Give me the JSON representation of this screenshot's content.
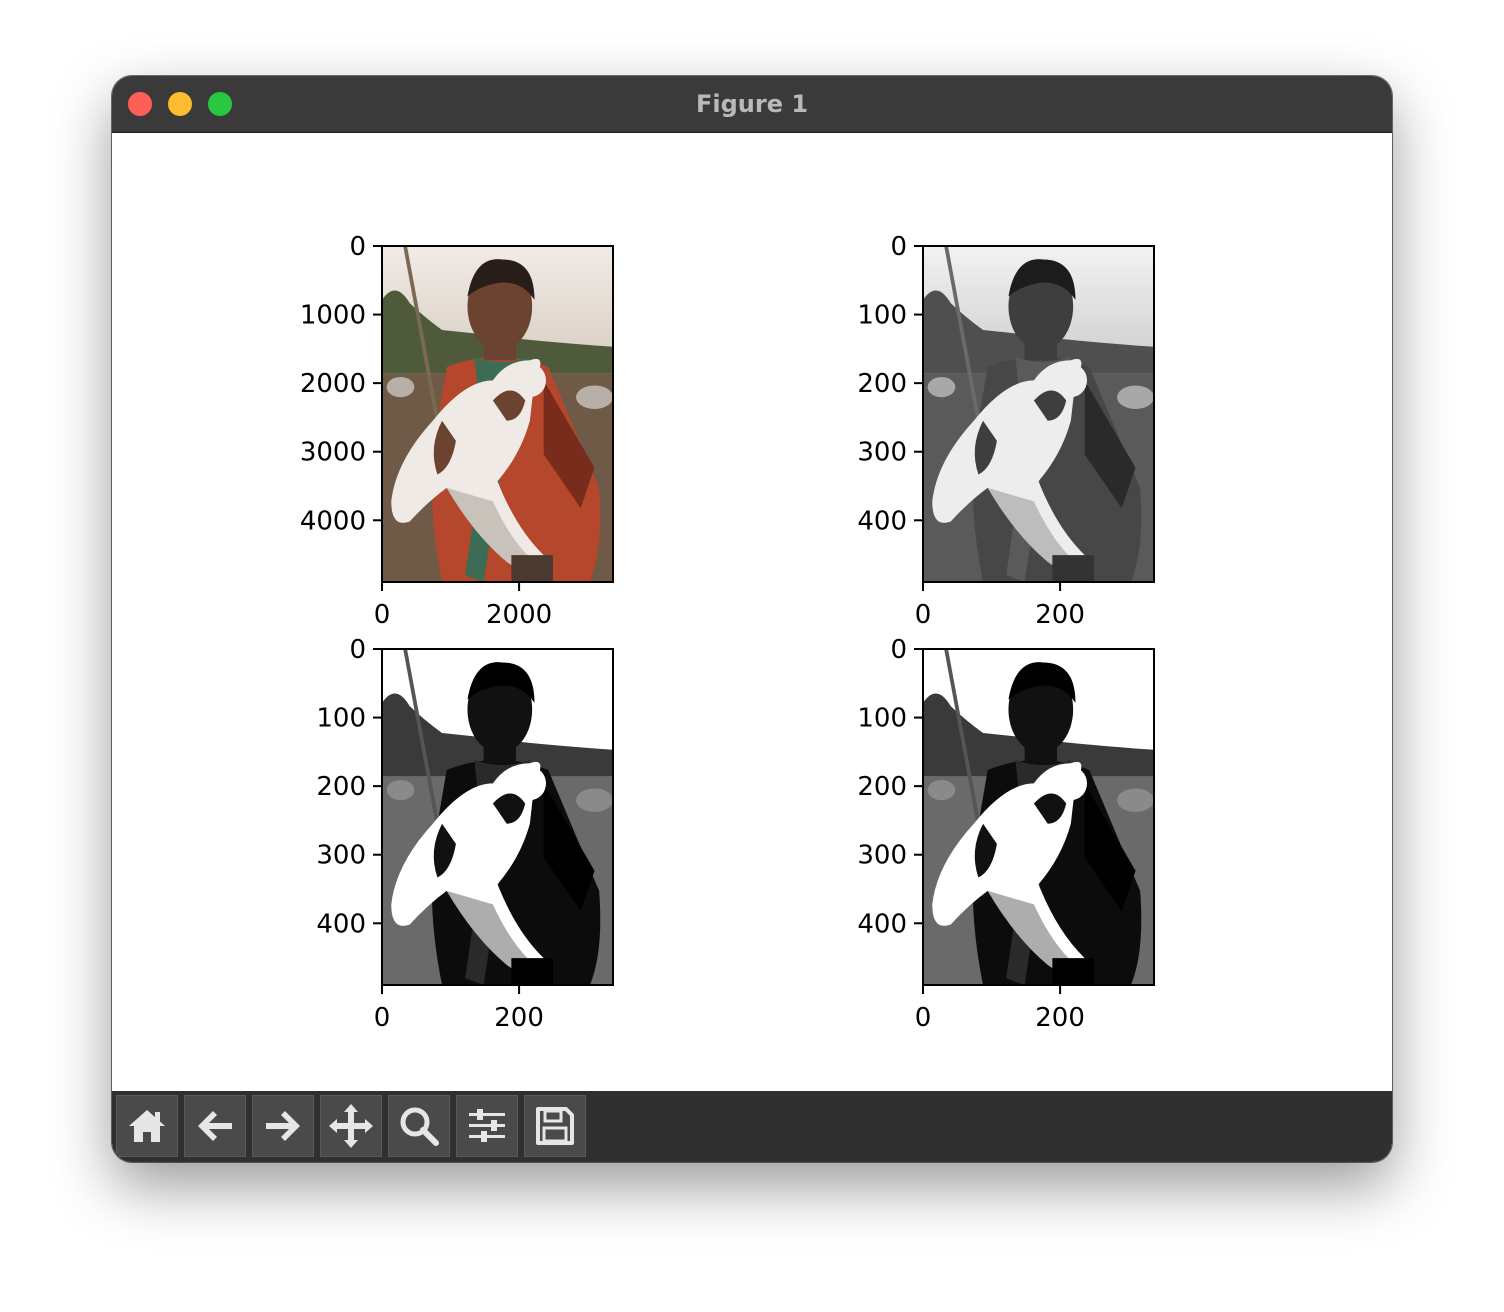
{
  "window": {
    "title": "Figure 1"
  },
  "toolbar": {
    "buttons": [
      {
        "icon": "home-icon"
      },
      {
        "icon": "back-arrow-icon"
      },
      {
        "icon": "forward-arrow-icon"
      },
      {
        "icon": "pan-move-icon"
      },
      {
        "icon": "zoom-magnifier-icon"
      },
      {
        "icon": "configure-subplots-icon"
      },
      {
        "icon": "save-floppy-icon"
      }
    ]
  },
  "chart_data": [
    {
      "type": "image",
      "colormap": "color",
      "y_ticks": [
        "0",
        "1000",
        "2000",
        "3000",
        "4000"
      ],
      "x_ticks": [
        "0",
        "2000"
      ],
      "xlim": [
        0,
        3370
      ],
      "ylim": [
        4900,
        0
      ]
    },
    {
      "type": "image",
      "colormap": "grayscale",
      "y_ticks": [
        "0",
        "100",
        "200",
        "300",
        "400"
      ],
      "x_ticks": [
        "0",
        "200"
      ],
      "xlim": [
        0,
        337
      ],
      "ylim": [
        490,
        0
      ]
    },
    {
      "type": "image",
      "colormap": "grayscale-posterized",
      "y_ticks": [
        "0",
        "100",
        "200",
        "300",
        "400"
      ],
      "x_ticks": [
        "0",
        "200"
      ],
      "xlim": [
        0,
        337
      ],
      "ylim": [
        490,
        0
      ]
    },
    {
      "type": "image",
      "colormap": "grayscale-posterized",
      "y_ticks": [
        "0",
        "100",
        "200",
        "300",
        "400"
      ],
      "x_ticks": [
        "0",
        "200"
      ],
      "xlim": [
        0,
        337
      ],
      "ylim": [
        490,
        0
      ]
    }
  ],
  "colors": {
    "titlebar": "#3a3a3a",
    "toolbar": "#303030",
    "close": "#ff5f57",
    "minimize": "#febc2e",
    "maximize": "#28c840"
  }
}
